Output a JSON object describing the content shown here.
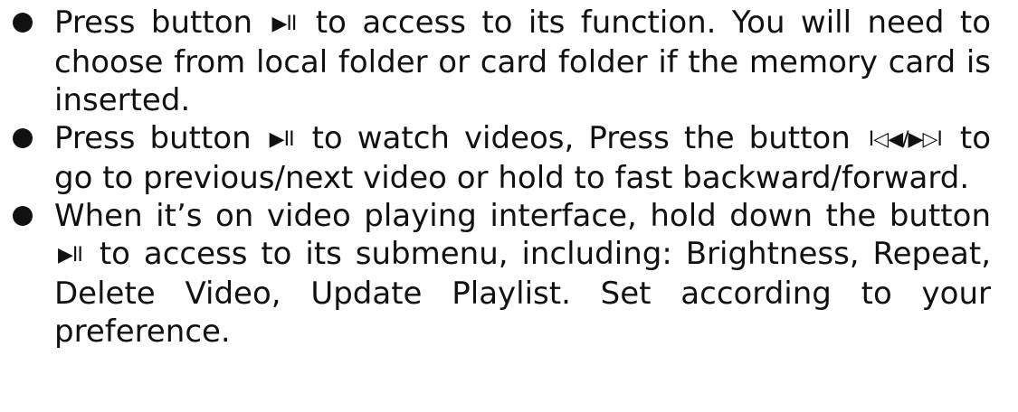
{
  "items": [
    {
      "part1": "Press button",
      "icon1": "▶II",
      "part2": "to access to its function. You will need to choose from local folder or card folder if the memory card is inserted."
    },
    {
      "part1": "Press button",
      "icon1": "▶II",
      "part2": "to watch videos, Press the button",
      "icon2": "I◁◀/▶▷I",
      "part3": "to go to previous/next video or hold to fast backward/forward."
    },
    {
      "part1": "When it’s on video playing interface, hold down the button",
      "icon1": "▶II",
      "part2": "to access to its submenu, including: Brightness, Repeat, Delete Video, Update Playlist. Set according to your preference."
    }
  ],
  "icons": {
    "bullet": "filled-circle-bullet",
    "play_pause": "play-pause-icon",
    "prev_next": "prev-next-icon"
  }
}
